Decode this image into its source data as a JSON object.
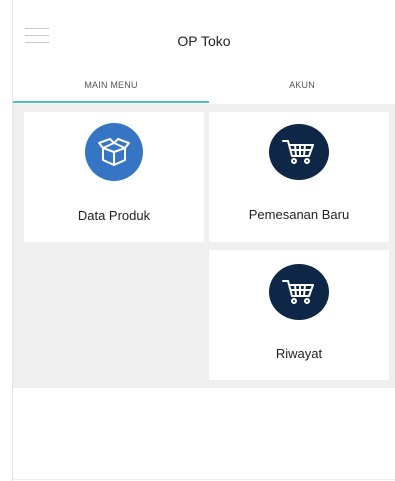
{
  "app": {
    "title": "OP Toko",
    "menu_icon": "hamburger-icon"
  },
  "tabs": [
    {
      "label": "MAIN MENU",
      "active": true
    },
    {
      "label": "AKUN",
      "active": false
    }
  ],
  "colors": {
    "tab_indicator": "#4fc3c3",
    "produk_icon_bg": "#3575c4",
    "cart_icon_bg": "#0e2747",
    "content_bg": "#efefef"
  },
  "menu": [
    {
      "label": "Data Produk",
      "icon": "box-icon"
    },
    {
      "label": "Pemesanan Baru",
      "icon": "cart-icon"
    },
    {
      "label": "Riwayat",
      "icon": "cart-icon"
    }
  ]
}
